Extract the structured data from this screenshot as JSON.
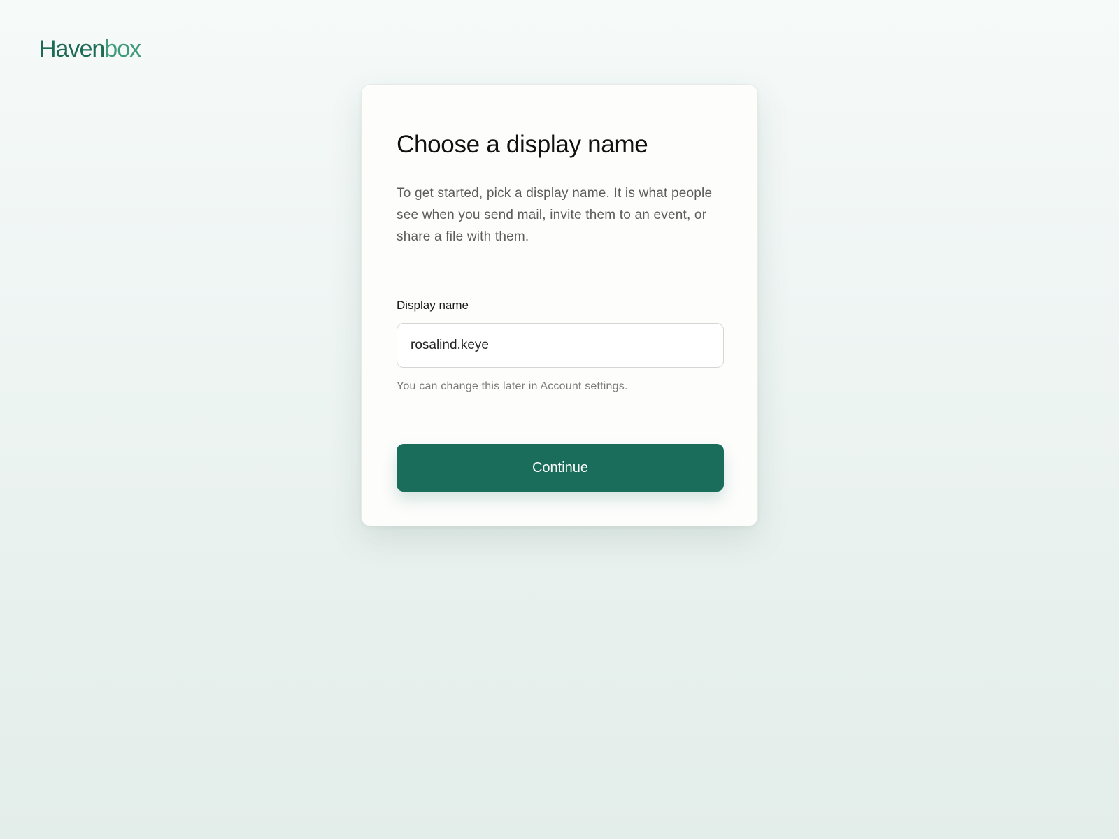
{
  "brand": {
    "name_part1": "Haven",
    "name_part2": "box",
    "colors": {
      "primary": "#1d6b55",
      "secondary": "#3f9a7a"
    }
  },
  "card": {
    "title": "Choose a display name",
    "description": "To get started, pick a display name. It is what people see when you send mail, invite them to an event, or share a file with them.",
    "field": {
      "label": "Display name",
      "value": "rosalind.keye",
      "helper": "You can change this later in Account settings."
    },
    "continue_button": "Continue"
  },
  "colors": {
    "accent": "#196d5a",
    "background": "#edf4f2"
  }
}
